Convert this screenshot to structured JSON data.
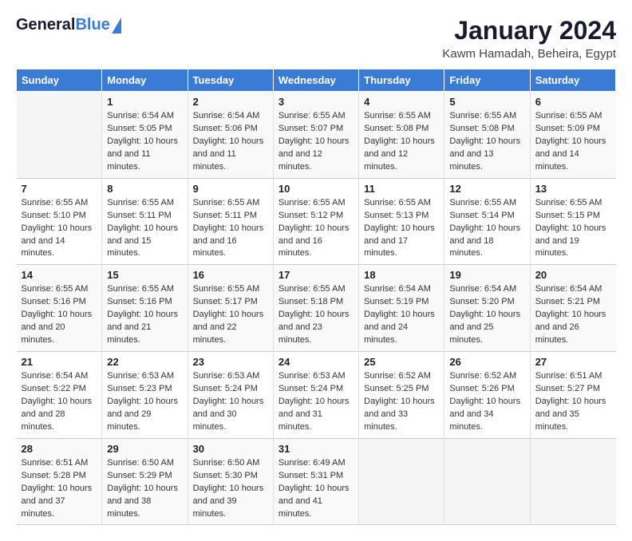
{
  "header": {
    "logo_general": "General",
    "logo_blue": "Blue",
    "month_title": "January 2024",
    "subtitle": "Kawm Hamadah, Beheira, Egypt"
  },
  "days_of_week": [
    "Sunday",
    "Monday",
    "Tuesday",
    "Wednesday",
    "Thursday",
    "Friday",
    "Saturday"
  ],
  "weeks": [
    [
      {
        "day": "",
        "sunrise": "",
        "sunset": "",
        "daylight": "",
        "empty": true
      },
      {
        "day": "1",
        "sunrise": "Sunrise: 6:54 AM",
        "sunset": "Sunset: 5:05 PM",
        "daylight": "Daylight: 10 hours and 11 minutes."
      },
      {
        "day": "2",
        "sunrise": "Sunrise: 6:54 AM",
        "sunset": "Sunset: 5:06 PM",
        "daylight": "Daylight: 10 hours and 11 minutes."
      },
      {
        "day": "3",
        "sunrise": "Sunrise: 6:55 AM",
        "sunset": "Sunset: 5:07 PM",
        "daylight": "Daylight: 10 hours and 12 minutes."
      },
      {
        "day": "4",
        "sunrise": "Sunrise: 6:55 AM",
        "sunset": "Sunset: 5:08 PM",
        "daylight": "Daylight: 10 hours and 12 minutes."
      },
      {
        "day": "5",
        "sunrise": "Sunrise: 6:55 AM",
        "sunset": "Sunset: 5:08 PM",
        "daylight": "Daylight: 10 hours and 13 minutes."
      },
      {
        "day": "6",
        "sunrise": "Sunrise: 6:55 AM",
        "sunset": "Sunset: 5:09 PM",
        "daylight": "Daylight: 10 hours and 14 minutes."
      }
    ],
    [
      {
        "day": "7",
        "sunrise": "Sunrise: 6:55 AM",
        "sunset": "Sunset: 5:10 PM",
        "daylight": "Daylight: 10 hours and 14 minutes."
      },
      {
        "day": "8",
        "sunrise": "Sunrise: 6:55 AM",
        "sunset": "Sunset: 5:11 PM",
        "daylight": "Daylight: 10 hours and 15 minutes."
      },
      {
        "day": "9",
        "sunrise": "Sunrise: 6:55 AM",
        "sunset": "Sunset: 5:11 PM",
        "daylight": "Daylight: 10 hours and 16 minutes."
      },
      {
        "day": "10",
        "sunrise": "Sunrise: 6:55 AM",
        "sunset": "Sunset: 5:12 PM",
        "daylight": "Daylight: 10 hours and 16 minutes."
      },
      {
        "day": "11",
        "sunrise": "Sunrise: 6:55 AM",
        "sunset": "Sunset: 5:13 PM",
        "daylight": "Daylight: 10 hours and 17 minutes."
      },
      {
        "day": "12",
        "sunrise": "Sunrise: 6:55 AM",
        "sunset": "Sunset: 5:14 PM",
        "daylight": "Daylight: 10 hours and 18 minutes."
      },
      {
        "day": "13",
        "sunrise": "Sunrise: 6:55 AM",
        "sunset": "Sunset: 5:15 PM",
        "daylight": "Daylight: 10 hours and 19 minutes."
      }
    ],
    [
      {
        "day": "14",
        "sunrise": "Sunrise: 6:55 AM",
        "sunset": "Sunset: 5:16 PM",
        "daylight": "Daylight: 10 hours and 20 minutes."
      },
      {
        "day": "15",
        "sunrise": "Sunrise: 6:55 AM",
        "sunset": "Sunset: 5:16 PM",
        "daylight": "Daylight: 10 hours and 21 minutes."
      },
      {
        "day": "16",
        "sunrise": "Sunrise: 6:55 AM",
        "sunset": "Sunset: 5:17 PM",
        "daylight": "Daylight: 10 hours and 22 minutes."
      },
      {
        "day": "17",
        "sunrise": "Sunrise: 6:55 AM",
        "sunset": "Sunset: 5:18 PM",
        "daylight": "Daylight: 10 hours and 23 minutes."
      },
      {
        "day": "18",
        "sunrise": "Sunrise: 6:54 AM",
        "sunset": "Sunset: 5:19 PM",
        "daylight": "Daylight: 10 hours and 24 minutes."
      },
      {
        "day": "19",
        "sunrise": "Sunrise: 6:54 AM",
        "sunset": "Sunset: 5:20 PM",
        "daylight": "Daylight: 10 hours and 25 minutes."
      },
      {
        "day": "20",
        "sunrise": "Sunrise: 6:54 AM",
        "sunset": "Sunset: 5:21 PM",
        "daylight": "Daylight: 10 hours and 26 minutes."
      }
    ],
    [
      {
        "day": "21",
        "sunrise": "Sunrise: 6:54 AM",
        "sunset": "Sunset: 5:22 PM",
        "daylight": "Daylight: 10 hours and 28 minutes."
      },
      {
        "day": "22",
        "sunrise": "Sunrise: 6:53 AM",
        "sunset": "Sunset: 5:23 PM",
        "daylight": "Daylight: 10 hours and 29 minutes."
      },
      {
        "day": "23",
        "sunrise": "Sunrise: 6:53 AM",
        "sunset": "Sunset: 5:24 PM",
        "daylight": "Daylight: 10 hours and 30 minutes."
      },
      {
        "day": "24",
        "sunrise": "Sunrise: 6:53 AM",
        "sunset": "Sunset: 5:24 PM",
        "daylight": "Daylight: 10 hours and 31 minutes."
      },
      {
        "day": "25",
        "sunrise": "Sunrise: 6:52 AM",
        "sunset": "Sunset: 5:25 PM",
        "daylight": "Daylight: 10 hours and 33 minutes."
      },
      {
        "day": "26",
        "sunrise": "Sunrise: 6:52 AM",
        "sunset": "Sunset: 5:26 PM",
        "daylight": "Daylight: 10 hours and 34 minutes."
      },
      {
        "day": "27",
        "sunrise": "Sunrise: 6:51 AM",
        "sunset": "Sunset: 5:27 PM",
        "daylight": "Daylight: 10 hours and 35 minutes."
      }
    ],
    [
      {
        "day": "28",
        "sunrise": "Sunrise: 6:51 AM",
        "sunset": "Sunset: 5:28 PM",
        "daylight": "Daylight: 10 hours and 37 minutes."
      },
      {
        "day": "29",
        "sunrise": "Sunrise: 6:50 AM",
        "sunset": "Sunset: 5:29 PM",
        "daylight": "Daylight: 10 hours and 38 minutes."
      },
      {
        "day": "30",
        "sunrise": "Sunrise: 6:50 AM",
        "sunset": "Sunset: 5:30 PM",
        "daylight": "Daylight: 10 hours and 39 minutes."
      },
      {
        "day": "31",
        "sunrise": "Sunrise: 6:49 AM",
        "sunset": "Sunset: 5:31 PM",
        "daylight": "Daylight: 10 hours and 41 minutes."
      },
      {
        "day": "",
        "sunrise": "",
        "sunset": "",
        "daylight": "",
        "empty": true
      },
      {
        "day": "",
        "sunrise": "",
        "sunset": "",
        "daylight": "",
        "empty": true
      },
      {
        "day": "",
        "sunrise": "",
        "sunset": "",
        "daylight": "",
        "empty": true
      }
    ]
  ]
}
